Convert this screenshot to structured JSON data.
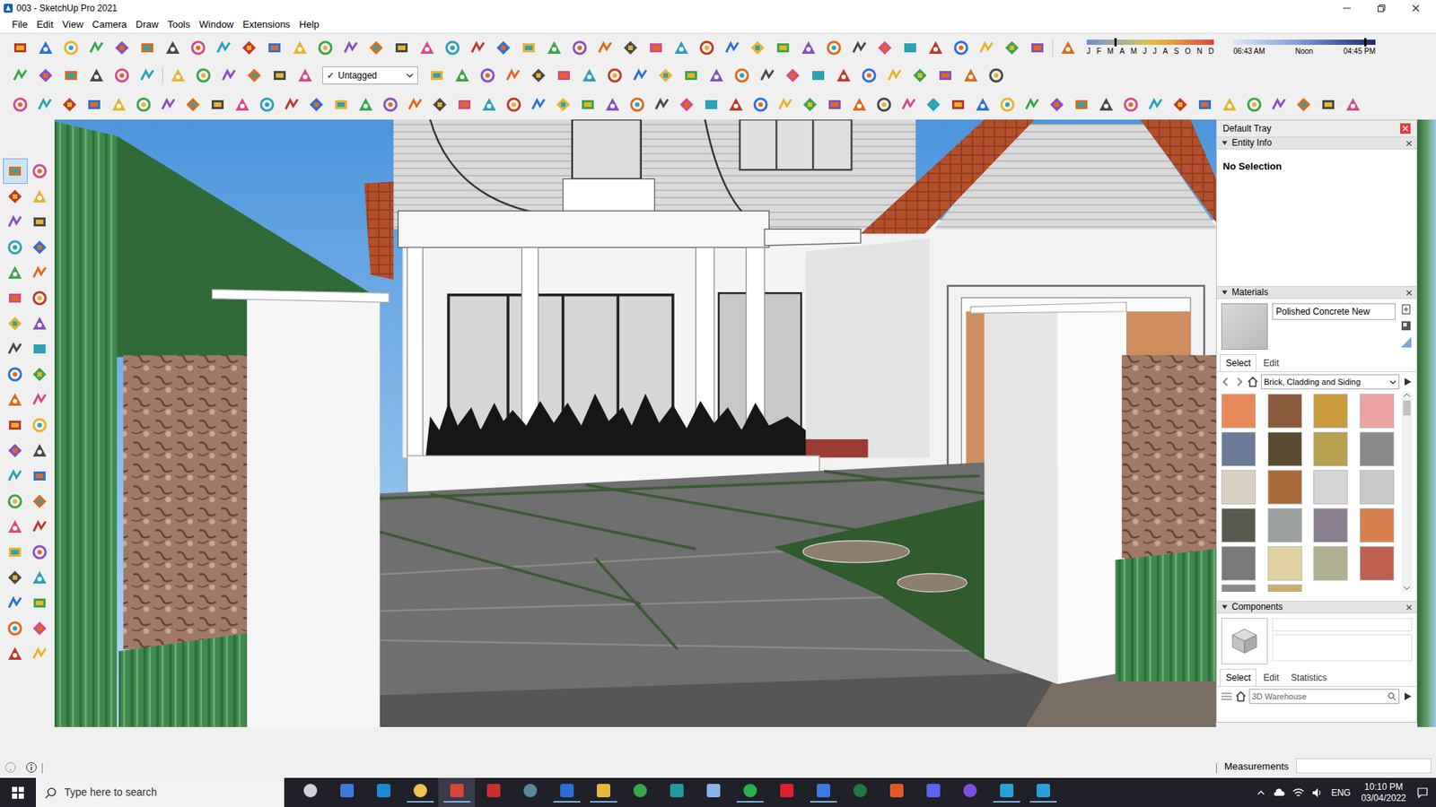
{
  "window": {
    "title": "003 - SketchUp Pro 2021"
  },
  "menu": [
    "File",
    "Edit",
    "View",
    "Camera",
    "Draw",
    "Tools",
    "Window",
    "Extensions",
    "Help"
  ],
  "shadow_settings": {
    "months": [
      "J",
      "F",
      "M",
      "A",
      "M",
      "J",
      "J",
      "A",
      "S",
      "O",
      "N",
      "D"
    ],
    "date_level": 0.22,
    "times": [
      "06:43 AM",
      "Noon",
      "04:45 PM"
    ],
    "time_level": 0.92
  },
  "tag_dropdown": {
    "mark": "✓",
    "value": "Untagged"
  },
  "left_toolbar": {
    "select_tool_active": true
  },
  "tray": {
    "title": "Default Tray",
    "entity_info": {
      "title": "Entity Info",
      "selection": "No Selection"
    },
    "materials": {
      "title": "Materials",
      "name": "Polished Concrete New",
      "tabs": [
        {
          "label": "Select",
          "selected": true
        },
        {
          "label": "Edit",
          "selected": false
        }
      ],
      "category": "Brick, Cladding and Siding",
      "swatches": [
        {
          "color": "#e8895a"
        },
        {
          "color": "#8b5a3c"
        },
        {
          "color": "#c99a3a"
        },
        {
          "color": "#eba3a3"
        },
        {
          "color": "#6a7a98"
        },
        {
          "color": "#5a4a30"
        },
        {
          "color": "#b8a050"
        },
        {
          "color": "#8a8a8a"
        },
        {
          "color": "#d8d0c0"
        },
        {
          "color": "#a86a3a"
        },
        {
          "color": "#d4d4d4"
        },
        {
          "color": "#c8c8c8"
        },
        {
          "color": "#5a5a50"
        },
        {
          "color": "#9aa0a0"
        },
        {
          "color": "#8a8090"
        },
        {
          "color": "#d88050"
        },
        {
          "color": "#7a7a7a"
        },
        {
          "color": "#e0d0a0"
        },
        {
          "color": "#b0b090"
        },
        {
          "color": "#c06050"
        },
        {
          "color": "#8a8a8a"
        },
        {
          "color": "#c8b070"
        }
      ]
    },
    "components": {
      "title": "Components",
      "tabs": [
        {
          "label": "Select",
          "selected": true
        },
        {
          "label": "Edit",
          "selected": false
        },
        {
          "label": "Statistics",
          "selected": false
        }
      ],
      "search_placeholder": "3D Warehouse"
    }
  },
  "status_bar": {
    "measurements_label": "Measurements",
    "measurements_value": ""
  },
  "taskbar": {
    "search_placeholder": "Type here to search",
    "language": "ENG",
    "time": "10:10 PM",
    "date": "03/04/2022",
    "apps": [
      {
        "open": false,
        "active": false
      },
      {
        "open": false,
        "active": false
      },
      {
        "open": false,
        "active": false
      },
      {
        "open": true,
        "active": false
      },
      {
        "open": true,
        "active": true
      },
      {
        "open": false,
        "active": false
      },
      {
        "open": false,
        "active": false
      },
      {
        "open": true,
        "active": false
      },
      {
        "open": true,
        "active": false
      },
      {
        "open": false,
        "active": false
      },
      {
        "open": false,
        "active": false
      },
      {
        "open": false,
        "active": false
      },
      {
        "open": true,
        "active": false
      },
      {
        "open": false,
        "active": false
      },
      {
        "open": true,
        "active": false
      },
      {
        "open": false,
        "active": false
      },
      {
        "open": false,
        "active": false
      },
      {
        "open": false,
        "active": false
      },
      {
        "open": false,
        "active": false
      },
      {
        "open": true,
        "active": false
      },
      {
        "open": true,
        "active": false
      }
    ]
  }
}
